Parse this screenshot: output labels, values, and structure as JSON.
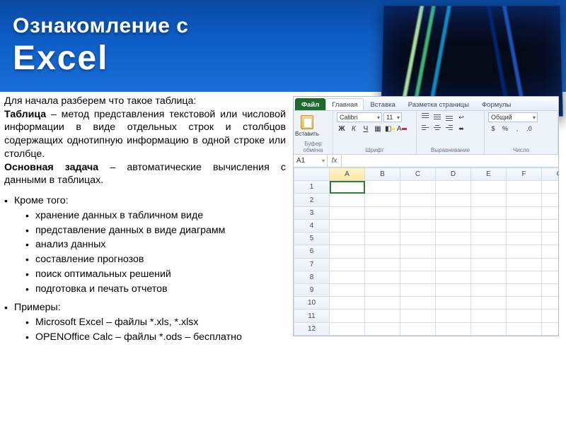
{
  "slide": {
    "title_line1": "Ознакомление с",
    "title_line2": "Excel"
  },
  "intro": {
    "lead": "Для начала разберем что такое таблица:",
    "term": "Таблица ",
    "def": "– метод представления текстовой или числовой информации в виде отдельных строк и столбцов содержащих однотипную информацию в одной строке или столбце.",
    "main_task_label": "Основная задача ",
    "main_task_text": "– автоматические вычисления с данными в таблицах."
  },
  "extras_label": "Кроме того:",
  "extras": [
    "хранение данных в табличном виде",
    "представление данных в виде диаграмм",
    "анализ данных",
    "составление прогнозов",
    "поиск оптимальных решений",
    "подготовка и печать отчетов"
  ],
  "examples_label": "Примеры:",
  "examples": [
    "Microsoft Excel – файлы *.xls, *.xlsx",
    "OPENOffice Calc – файлы *.ods – бесплатно"
  ],
  "excel": {
    "tabs": {
      "file": "Файл",
      "home": "Главная",
      "insert": "Вставка",
      "layout": "Разметка страницы",
      "formulas": "Формулы"
    },
    "ribbon": {
      "clipboard_label": "Буфер обмена",
      "font_label": "Шрифт",
      "align_label": "Выравнивание",
      "number_label": "Число",
      "paste_label": "Вставить",
      "font_name": "Calibri",
      "font_size": "11",
      "number_format": "Общий"
    },
    "namebox": "A1",
    "columns": [
      "A",
      "B",
      "C",
      "D",
      "E",
      "F",
      "G"
    ],
    "rows": [
      1,
      2,
      3,
      4,
      5,
      6,
      7,
      8,
      9,
      10,
      11,
      12
    ]
  }
}
